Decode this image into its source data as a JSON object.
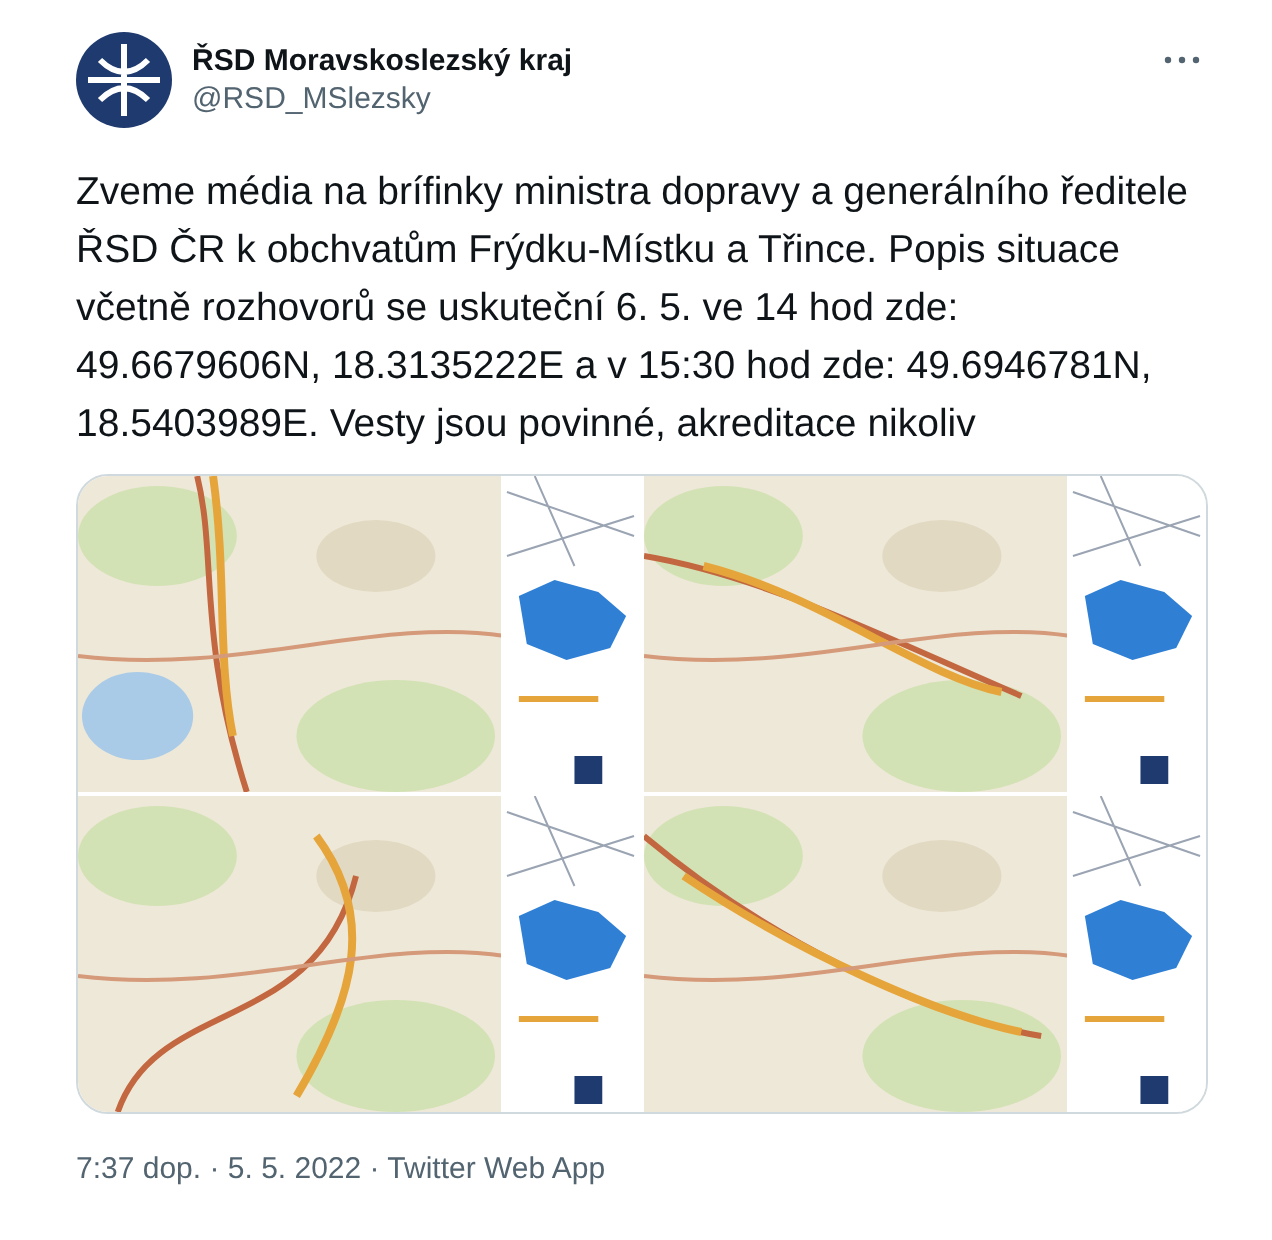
{
  "tweet": {
    "author": {
      "name": "ŘSD Moravskoslezský kraj",
      "handle": "@RSD_MSlezsky"
    },
    "text": "Zveme média na brífinky ministra dopravy a generálního ředitele ŘSD ČR k obchvatům Frýdku-Místku a Třince. Popis situace včetně rozhovorů se uskuteční 6. 5. ve 14 hod zde: 49.6679606N, 18.3135222E a v 15:30 hod zde: 49.6946781N, 18.5403989E. Vesty jsou povinné, akreditace nikoliv",
    "footer": "7:37 dop. · 5. 5. 2022 · Twitter Web App"
  }
}
